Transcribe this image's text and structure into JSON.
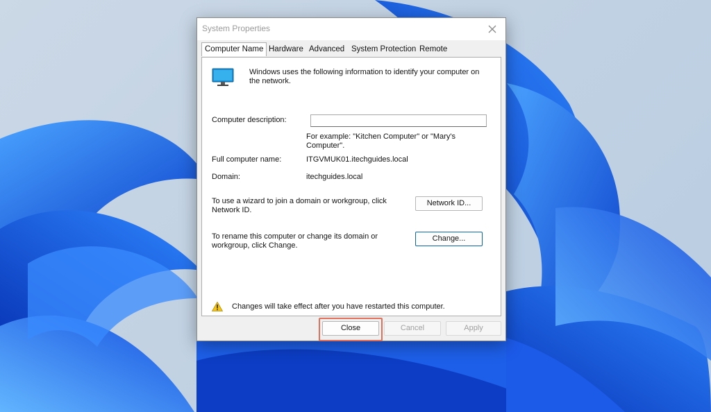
{
  "dialog": {
    "title": "System Properties",
    "tabs": [
      "Computer Name",
      "Hardware",
      "Advanced",
      "System Protection",
      "Remote"
    ],
    "active_tab": "Computer Name"
  },
  "content": {
    "intro_line1": "Windows uses the following information to identify your computer on",
    "intro_line2": "the network.",
    "description_label": "Computer description:",
    "description_value": "",
    "example_line1": "For example: \"Kitchen Computer\" or \"Mary's",
    "example_line2": "Computer\".",
    "full_name_label": "Full computer name:",
    "full_name_value": "ITGVMUK01.itechguides.local",
    "domain_label": "Domain:",
    "domain_value": "itechguides.local",
    "wizard_text_line1": "To use a wizard to join a domain or workgroup, click",
    "wizard_text_line2": "Network ID.",
    "network_id_button": "Network ID...",
    "rename_text_line1": "To rename this computer or change its domain or",
    "rename_text_line2": "workgroup, click Change.",
    "change_button": "Change...",
    "warning_text": "Changes will take effect after you have restarted this computer."
  },
  "footer": {
    "close_button": "Close",
    "cancel_button": "Cancel",
    "apply_button": "Apply"
  },
  "colors": {
    "accent": "#0a64ad",
    "highlight_box": "#e0705a",
    "wallpaper_blue": "#1463e6",
    "warning_yellow": "#f5c518"
  },
  "icons": [
    "monitor-icon",
    "close-icon",
    "warning-icon"
  ]
}
